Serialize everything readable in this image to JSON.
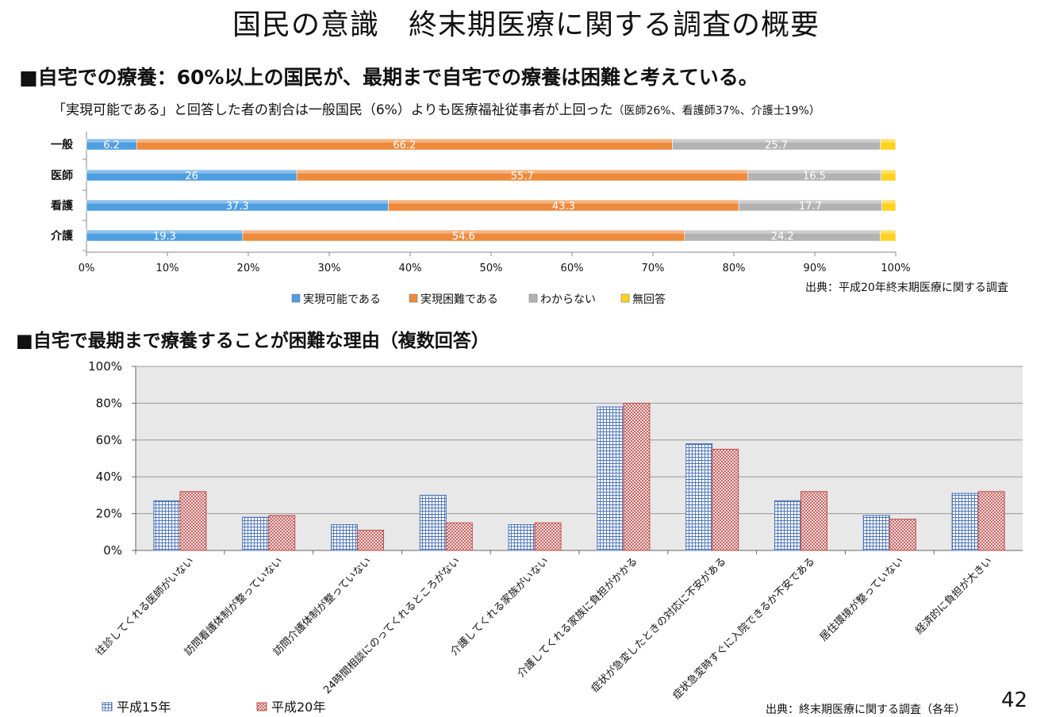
{
  "page": {
    "title": "国民の意識　終末期医療に関する調査の概要",
    "section1_heading": "■自宅での療養：60%以上の国民が、最期まで自宅での療養は困難と考えている。",
    "section1_subtitle": "「実現可能である」と回答した者の割合は一般国民（6%）よりも医療福祉従事者が上回った",
    "section1_subtitle_detail": "（医師26%、看護師37%、介護士19%）",
    "section1_source": "出典：平成20年終末期医療に関する調査",
    "section2_heading": "■自宅で最期まで療養することが困難な理由（複数回答）",
    "section2_source": "出典：終末期医療に関する調査（各年）",
    "page_number": "42"
  },
  "chart_data": [
    {
      "type": "bar",
      "orientation": "horizontal",
      "stacked": true,
      "categories": [
        "一般",
        "医師",
        "看護",
        "介護"
      ],
      "series": [
        {
          "name": "実現可能である",
          "values": [
            6.2,
            26,
            37.3,
            19.3
          ],
          "color": "#4f9ee0"
        },
        {
          "name": "実現困難である",
          "values": [
            66.2,
            55.7,
            43.3,
            54.6
          ],
          "color": "#ee8a3c"
        },
        {
          "name": "わからない",
          "values": [
            25.7,
            16.5,
            17.7,
            24.2
          ],
          "color": "#b2b2b2"
        },
        {
          "name": "無回答",
          "values": [
            1.9,
            1.8,
            1.7,
            1.9
          ],
          "color": "#ffd21f"
        }
      ],
      "xlim": [
        0,
        100
      ],
      "xticks": [
        "0%",
        "10%",
        "20%",
        "30%",
        "40%",
        "50%",
        "60%",
        "70%",
        "80%",
        "90%",
        "100%"
      ],
      "legend": "bottom",
      "grid": false
    },
    {
      "type": "bar",
      "orientation": "vertical",
      "categories": [
        "往診してくれる医師がいない",
        "訪問看護体制が整っていない",
        "訪問介護体制が整っていない",
        "24時間相談にのってくれるところがない",
        "介護してくれる家族がいない",
        "介護してくれる家族に負担がかかる",
        "症状が急変したときの対応に不安がある",
        "症状急変時すぐに入院できるか不安である",
        "居住環境が整っていない",
        "経済的に負担が大きい"
      ],
      "series": [
        {
          "name": "平成15年",
          "values": [
            27,
            18,
            14,
            30,
            14,
            78,
            58,
            27,
            19,
            31
          ],
          "color": "#4a72b8"
        },
        {
          "name": "平成20年",
          "values": [
            32,
            19,
            11,
            15,
            15,
            80,
            55,
            32,
            17,
            32
          ],
          "color": "#c0504d"
        }
      ],
      "ylim": [
        0,
        100
      ],
      "yticks": [
        "0%",
        "20%",
        "40%",
        "60%",
        "80%",
        "100%"
      ],
      "grid": true,
      "legend": "bottom-left"
    }
  ]
}
